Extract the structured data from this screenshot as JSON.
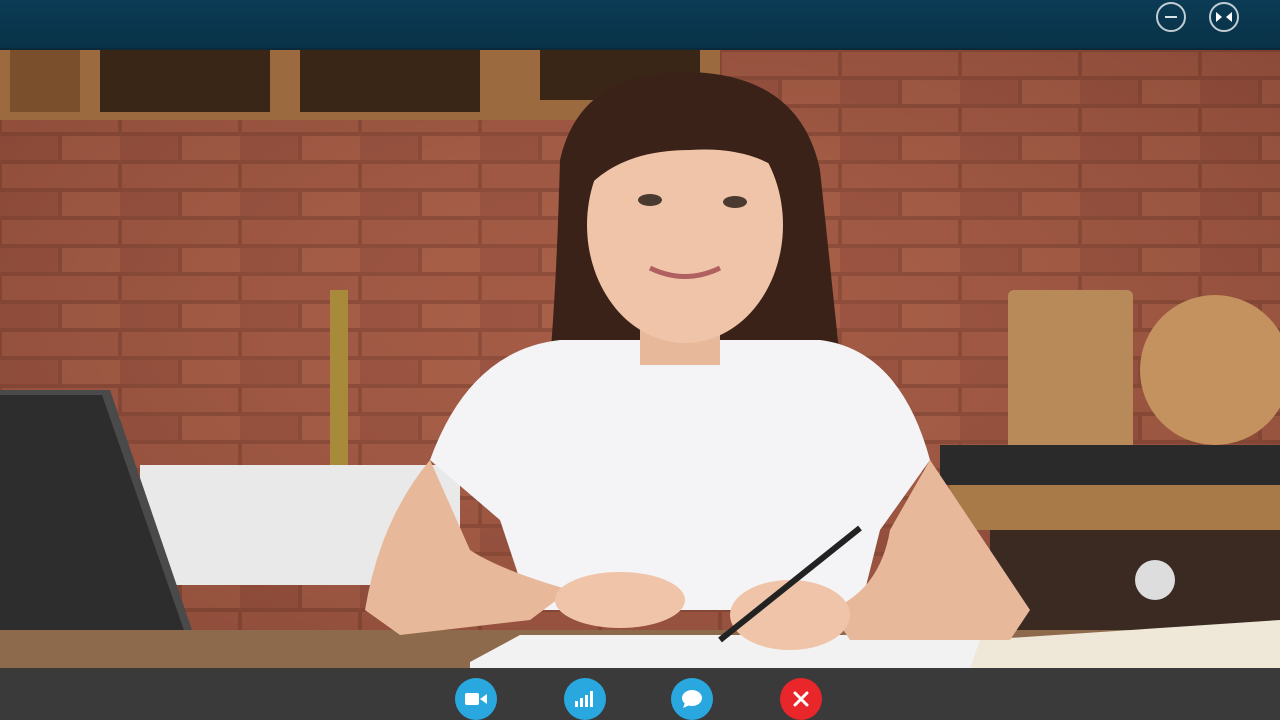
{
  "window": {
    "controls": [
      {
        "name": "minimize",
        "icon": "minimize-icon"
      },
      {
        "name": "fullscreen",
        "icon": "fullscreen-icon"
      }
    ],
    "title_bar_color": "#0b3b55"
  },
  "video": {
    "description_icon": "video-feed"
  },
  "call_controls": {
    "buttons": [
      {
        "name": "camera",
        "icon": "video-camera-icon",
        "color": "#29a8e0"
      },
      {
        "name": "signal",
        "icon": "signal-bars-icon",
        "color": "#29a8e0"
      },
      {
        "name": "chat",
        "icon": "chat-bubble-icon",
        "color": "#29a8e0"
      },
      {
        "name": "end-call",
        "icon": "close-icon",
        "color": "#e9262a"
      }
    ],
    "bar_color": "#3a3a3a"
  }
}
